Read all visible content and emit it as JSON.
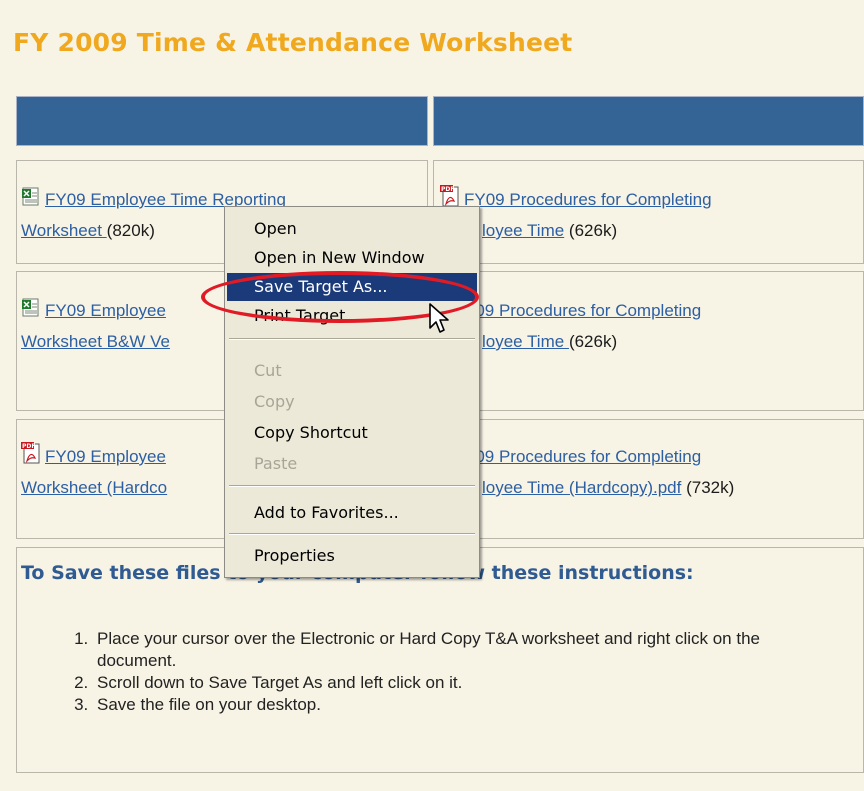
{
  "page": {
    "title": "FY 2009 Time & Attendance Worksheet"
  },
  "rows": [
    {
      "left": {
        "icon": "excel-icon",
        "link_a": "FY09 Employee Time Reporting",
        "link_b": "Worksheet ",
        "size": "(820k)"
      },
      "right": {
        "icon": "pdf-icon",
        "link_a": "FY09 Procedures for Completing",
        "link_b": "loyee Time",
        "size": " (626k)"
      }
    },
    {
      "left": {
        "icon": "excel-icon",
        "link_a": "FY09 Employee",
        "link_b": "Worksheet B&W Ve",
        "size": ""
      },
      "right": {
        "icon": "pdf-icon",
        "link_a": "Y09 Procedures for Completing",
        "link_b": "loyee Time ",
        "size": "(626k)"
      }
    },
    {
      "left": {
        "icon": "pdf-icon",
        "link_a": "FY09 Employee",
        "link_b": "Worksheet (Hardco",
        "size": ""
      },
      "right": {
        "icon": "pdf-icon",
        "link_a": "Y09 Procedures for Completing",
        "link_b": "loyee Time (Hardcopy).pdf",
        "size": " (732k)"
      }
    }
  ],
  "instructions": {
    "heading": "To Save these files to your computer follow these instructions:",
    "steps": [
      "Place your cursor over the Electronic or Hard Copy T&A worksheet and right click on the document.",
      "Scroll down to Save Target As and left click on it.",
      "Save the file on your desktop."
    ]
  },
  "context_menu": {
    "items": [
      {
        "label": "Open",
        "state": "enabled"
      },
      {
        "label": "Open in New Window",
        "state": "enabled"
      },
      {
        "label": "Save Target As...",
        "state": "selected"
      },
      {
        "label": "Print Target",
        "state": "enabled"
      },
      {
        "label": "Cut",
        "state": "disabled"
      },
      {
        "label": "Copy",
        "state": "disabled"
      },
      {
        "label": "Copy Shortcut",
        "state": "enabled"
      },
      {
        "label": "Paste",
        "state": "disabled"
      },
      {
        "label": "Add to Favorites...",
        "state": "enabled"
      },
      {
        "label": "Properties",
        "state": "enabled"
      }
    ]
  },
  "colors": {
    "title": "#f0a81e",
    "header_bar": "#346396",
    "link": "#2c5fa3",
    "highlight_ring": "#e01b25",
    "menu_selected": "#1b3a7a"
  }
}
